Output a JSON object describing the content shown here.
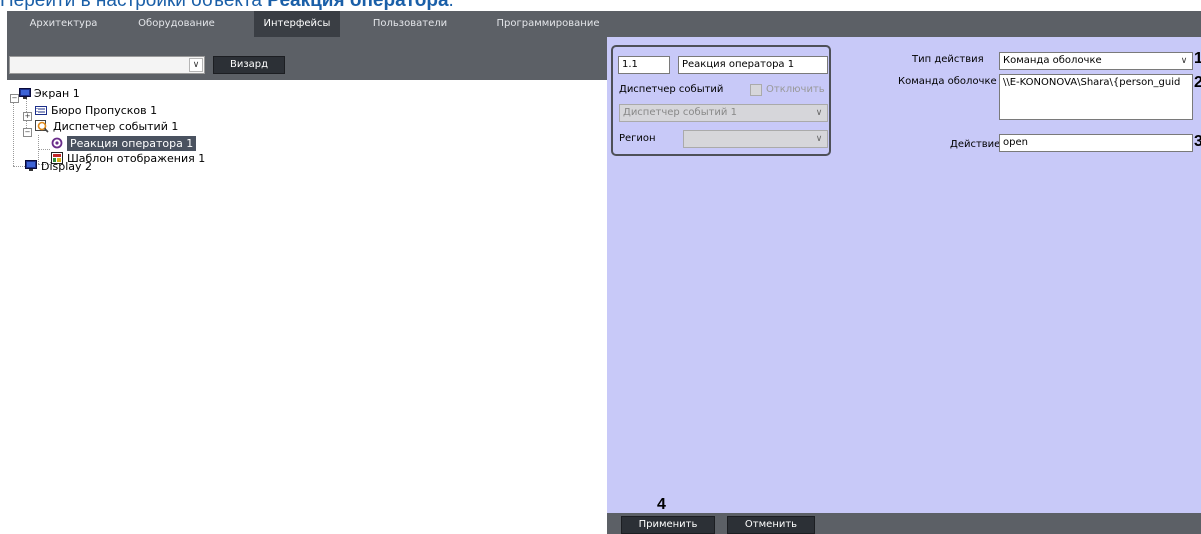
{
  "doc": {
    "heading_prefix": "Перейти в настройки объекта ",
    "heading_bold": "Реакция оператора",
    "heading_suffix": "."
  },
  "tabs": [
    {
      "label": "Архитектура"
    },
    {
      "label": "Оборудование"
    },
    {
      "label": "Интерфейсы",
      "active": true
    },
    {
      "label": "Пользователи"
    },
    {
      "label": "Программирование"
    }
  ],
  "toolbar": {
    "combo_value": "",
    "wizard_label": "Визард"
  },
  "tree": {
    "screen1": "Экран 1",
    "badge_office": "Бюро Пропусков 1",
    "event_dispatcher": "Диспетчер событий 1",
    "operator_reaction": "Реакция оператора 1",
    "display_template": "Шаблон отображения 1",
    "display2": "Display 2"
  },
  "props": {
    "id_value": "1.1",
    "name_value": "Реакция оператора 1",
    "dispatcher_label": "Диспетчер событий",
    "disable_label": "Отключить",
    "dispatcher_select": "Диспетчер событий 1",
    "region_label": "Регион",
    "region_select": ""
  },
  "action": {
    "type_label": "Тип действия",
    "type_value": "Команда оболочке",
    "command_label": "Команда оболочке",
    "command_value": "\\\\E-KONONOVA\\Shara\\{person_guid",
    "action_label": "Действие",
    "action_value": "open"
  },
  "callouts": {
    "c1": "1",
    "c2": "2",
    "c3": "3",
    "c4": "4"
  },
  "buttons": {
    "apply": "Применить",
    "cancel": "Отменить"
  },
  "colors": {
    "panel": "#c8c9f8",
    "bar": "#5c6066",
    "heading": "#1a5fa8"
  }
}
